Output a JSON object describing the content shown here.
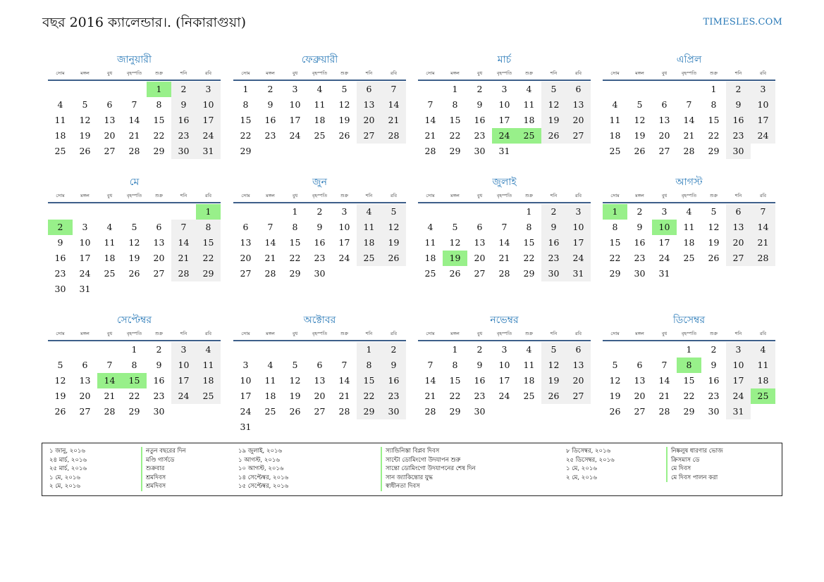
{
  "header": {
    "title": "বছর 2016 ক্যালেন্ডার।. (নিকারাগুয়া)",
    "site": "TIMESLES.COM"
  },
  "weekdays": [
    "সোম",
    "মঙ্গল",
    "বুধ",
    "বৃহস্পতি",
    "শুক্র",
    "শনি",
    "রবি"
  ],
  "colors": {
    "accent": "#2a7ab8",
    "holiday": "#98f08a",
    "weekend": "#f0f0f0",
    "rule": "#3d5f8a"
  },
  "months": [
    {
      "name": "জানুয়ারী",
      "start": 4,
      "days": 31,
      "holidays": [
        1
      ]
    },
    {
      "name": "ফেব্রুয়ারী",
      "start": 0,
      "days": 29,
      "holidays": []
    },
    {
      "name": "মার্চ",
      "start": 1,
      "days": 31,
      "holidays": [
        24,
        25
      ]
    },
    {
      "name": "এপ্রিল",
      "start": 4,
      "days": 30,
      "holidays": []
    },
    {
      "name": "মে",
      "start": 6,
      "days": 31,
      "holidays": [
        1,
        2
      ]
    },
    {
      "name": "জুন",
      "start": 2,
      "days": 30,
      "holidays": []
    },
    {
      "name": "জুলাই",
      "start": 4,
      "days": 31,
      "holidays": [
        19
      ]
    },
    {
      "name": "আগস্ট",
      "start": 0,
      "days": 31,
      "holidays": [
        1,
        10
      ]
    },
    {
      "name": "সেপ্টেম্বর",
      "start": 3,
      "days": 30,
      "holidays": [
        14,
        15
      ]
    },
    {
      "name": "অক্টোবর",
      "start": 5,
      "days": 31,
      "holidays": []
    },
    {
      "name": "নভেম্বর",
      "start": 1,
      "days": 30,
      "holidays": []
    },
    {
      "name": "ডিসেম্বর",
      "start": 3,
      "days": 31,
      "holidays": [
        8,
        25
      ]
    }
  ],
  "holidays_list": [
    [
      {
        "date": "১ জানু, ২০১৬",
        "name": "নতুন বছরের দিন"
      },
      {
        "date": "২৪ মার্চ, ২০১৬",
        "name": "মণ্ডি গার্সডে"
      },
      {
        "date": "২৫ মার্চ, ২০১৬",
        "name": "শুক্রবার"
      },
      {
        "date": "১ মে, ২০১৬",
        "name": "শ্রমদিবস"
      },
      {
        "date": "২ মে, ২০১৬",
        "name": "শ্রমদিবস"
      }
    ],
    [
      {
        "date": "১৯ জুলাই, ২০১৬",
        "name": "স্যান্ডিনিস্তা বিপ্লব দিবস"
      },
      {
        "date": "১ আগস্ট, ২০১৬",
        "name": "সান্টো ডোমিংগো উদযাপন শুরু"
      },
      {
        "date": "১০ আগস্ট, ২০১৬",
        "name": "সান্তো ডোমিংগো উদযাপনের শেষ দিন"
      },
      {
        "date": "১৪ সেপ্টেম্বর, ২০১৬",
        "name": "সান জ্যাকিন্তোর যুদ্ধ"
      },
      {
        "date": "১৫ সেপ্টেম্বর, ২০১৬",
        "name": "স্বাধীনতা দিবস"
      }
    ],
    [
      {
        "date": "৮ ডিসেম্বর, ২০১৬",
        "name": "নিষ্কলুষ ধারণার ভোজ"
      },
      {
        "date": "২৫ ডিসেম্বর, ২০১৬",
        "name": "ক্রিসমাস ডে"
      },
      {
        "date": "১ মে, ২০১৬",
        "name": "মে দিবস"
      },
      {
        "date": "২ মে, ২০১৬",
        "name": "মে দিবস পালন করা"
      }
    ]
  ]
}
